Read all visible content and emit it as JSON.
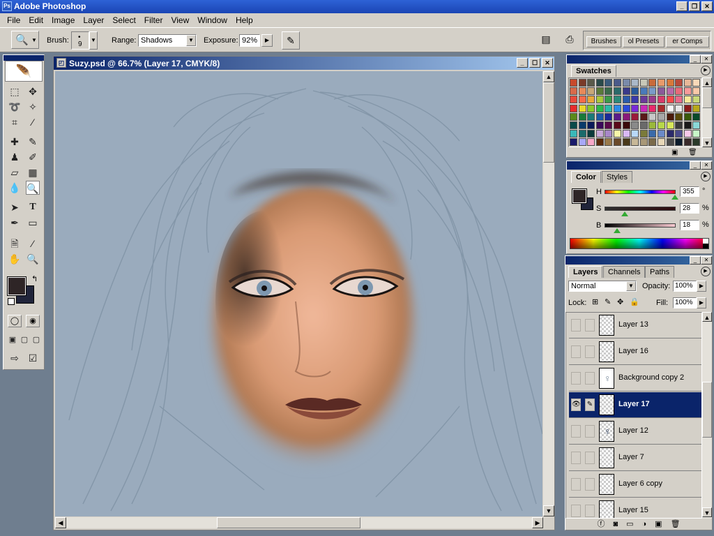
{
  "app": {
    "title": "Adobe Photoshop"
  },
  "menu": [
    "File",
    "Edit",
    "Image",
    "Layer",
    "Select",
    "Filter",
    "View",
    "Window",
    "Help"
  ],
  "options": {
    "brush_label": "Brush:",
    "brush_size": "9",
    "range_label": "Range:",
    "range_value": "Shadows",
    "exposure_label": "Exposure:",
    "exposure_value": "92%",
    "well_tabs": [
      "Brushes",
      "ol Presets",
      "er Comps"
    ]
  },
  "document": {
    "title": "Suzy.psd @ 66.7% (Layer 17, CMYK/8)"
  },
  "swatches": {
    "tab": "Swatches",
    "colors": [
      "#c84a2c",
      "#7a3a28",
      "#5a5a4a",
      "#2a4a4a",
      "#3a5a7a",
      "#4a5a8a",
      "#7a8aaa",
      "#aab8c8",
      "#c8c8b8",
      "#c86a3a",
      "#e89a6a",
      "#d8783a",
      "#b84a3a",
      "#e8b898",
      "#f8d8b8",
      "#d86a4a",
      "#e88a5a",
      "#c8a878",
      "#5a7a3a",
      "#3a6a4a",
      "#2a6a6a",
      "#3a3a8a",
      "#2a5a9a",
      "#4a7aba",
      "#7a9ac8",
      "#8a5a9a",
      "#b86aaa",
      "#e86a7a",
      "#f89a9a",
      "#f8c8a8",
      "#e84a3a",
      "#f86a4a",
      "#e8a83a",
      "#a8c83a",
      "#3a9a4a",
      "#2a8a7a",
      "#2a5aaa",
      "#3a3aaa",
      "#6a3a9a",
      "#9a3a8a",
      "#d83a6a",
      "#f84a4a",
      "#e86a8a",
      "#f8e898",
      "#c8d878",
      "#e82a2a",
      "#e8d82a",
      "#8ac82a",
      "#2ab84a",
      "#2ab8a8",
      "#2a8ae8",
      "#2a4ad8",
      "#7a2ad8",
      "#c82ab8",
      "#e82a6a",
      "#a82a2a",
      "#f8f8f8",
      "#e8e8e8",
      "#8a1a1a",
      "#b8a81a",
      "#5a8a1a",
      "#1a7a3a",
      "#1a7a7a",
      "#1a5aa8",
      "#1a2a9a",
      "#5a1a8a",
      "#8a1a7a",
      "#9a1a3a",
      "#5a1a1a",
      "#c8c8c8",
      "#a8a8a8",
      "#4a1a0a",
      "#5a4a0a",
      "#3a5a0a",
      "#0a4a2a",
      "#0a4a4a",
      "#0a3a6a",
      "#0a1a5a",
      "#3a0a5a",
      "#5a0a4a",
      "#5a0a1a",
      "#3a0a0a",
      "#8a8a8a",
      "#6a6a6a",
      "#9ab83a",
      "#b8d84a",
      "#d8e85a",
      "#3a3a3a",
      "#1a1a1a",
      "#8ad8d8",
      "#3ab8b8",
      "#1a6a6a",
      "#0a3a3a",
      "#c8a8d8",
      "#a888c8",
      "#f8f8a8",
      "#d8b8f8",
      "#b8d8f8",
      "#7a7a3a",
      "#3a6aaa",
      "#6a8ac8",
      "#2a2a6a",
      "#4a4a8a",
      "#f8c8e8",
      "#c8f8c8",
      "#1a1a6a",
      "#a8a8f8",
      "#f8a8c8",
      "#5a2a0a",
      "#9a7a4a",
      "#6a4a2a",
      "#4a3a1a",
      "#c8b898",
      "#a89878",
      "#7a6a4a",
      "#e8d8b8",
      "#4a4a4a",
      "#0a1a2a",
      "#3a2a2a",
      "#2a3a2a"
    ]
  },
  "color": {
    "tabs": [
      "Color",
      "Styles"
    ],
    "h_label": "H",
    "h_value": "355",
    "h_unit": "°",
    "s_label": "S",
    "s_value": "28",
    "s_unit": "%",
    "b_label": "B",
    "b_value": "18",
    "b_unit": "%",
    "h_fraction": 0.986,
    "s_fraction": 0.28,
    "b_fraction": 0.18,
    "fg_color": "#2e2526",
    "bg_color": "#20243a"
  },
  "layers": {
    "tabs": [
      "Layers",
      "Channels",
      "Paths"
    ],
    "blend_mode": "Normal",
    "opacity_label": "Opacity:",
    "opacity_value": "100%",
    "lock_label": "Lock:",
    "fill_label": "Fill:",
    "fill_value": "100%",
    "items": [
      {
        "name": "Layer 13"
      },
      {
        "name": "Layer 16"
      },
      {
        "name": "Background copy 2"
      },
      {
        "name": "Layer 17"
      },
      {
        "name": "Layer 12"
      },
      {
        "name": "Layer 7"
      },
      {
        "name": "Layer 6 copy"
      },
      {
        "name": "Layer 15"
      }
    ]
  }
}
